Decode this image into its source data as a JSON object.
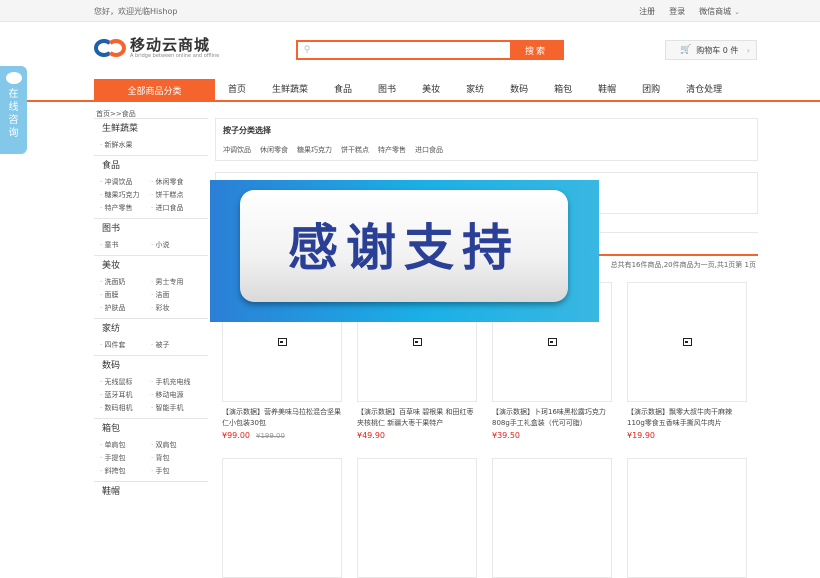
{
  "topbar": {
    "greeting": "您好，欢迎光临Hishop",
    "links": [
      "注册",
      "登录",
      "微信商城"
    ]
  },
  "header": {
    "logo_name": "移动云商城",
    "logo_slogan": "A bridge between online and offline",
    "search_placeholder": "",
    "search_button": "搜索",
    "cart_label": "购物车 0 件"
  },
  "nav": {
    "all_categories": "全部商品分类",
    "items": [
      "首页",
      "生鲜蔬菜",
      "食品",
      "图书",
      "美妆",
      "家纺",
      "数码",
      "箱包",
      "鞋帽",
      "团购",
      "清仓处理"
    ]
  },
  "consult": {
    "label": "在线咨询"
  },
  "breadcrumb": "首页>>食品",
  "sidebar": [
    {
      "title": "生鲜蔬菜",
      "items": [
        "新鲜水果"
      ]
    },
    {
      "title": "食品",
      "items": [
        "冲调饮品",
        "休闲零食",
        "糖果巧克力",
        "饼干糕点",
        "特产零售",
        "进口食品"
      ]
    },
    {
      "title": "图书",
      "items": [
        "童书",
        "小说"
      ]
    },
    {
      "title": "美妆",
      "items": [
        "洗面奶",
        "男士专用",
        "面膜",
        "洁面",
        "护肤品",
        "彩妆"
      ]
    },
    {
      "title": "家纺",
      "items": [
        "四件套",
        "被子"
      ]
    },
    {
      "title": "数码",
      "items": [
        "无线鼠标",
        "手机充电线",
        "蓝牙耳机",
        "移动电源",
        "数码相机",
        "智能手机"
      ]
    },
    {
      "title": "箱包",
      "items": [
        "单肩包",
        "双肩包",
        "手提包",
        "背包",
        "斜挎包",
        "手包"
      ]
    },
    {
      "title": "鞋帽",
      "items": []
    }
  ],
  "filter": {
    "title": "按子分类选择",
    "options": [
      "冲调饮品",
      "休闲零食",
      "糖果巧克力",
      "饼干糕点",
      "特产零售",
      "进口食品"
    ]
  },
  "pager_info": "总共有16件商品,20件商品为一页,共1页第 1页",
  "products": [
    {
      "title": "【演示数据】营养美味马拉松混合坚果仁小包装30包",
      "price": "¥99.00",
      "old_price": "¥199.00"
    },
    {
      "title": "【演示数据】百草味 碧根果 和田红枣夹核桃仁 新疆大枣干果特产",
      "price": "¥49.90",
      "old_price": ""
    },
    {
      "title": "【演示数据】卜珂16味黑松露巧克力808g手工礼盒装（代可可脂）",
      "price": "¥39.50",
      "old_price": ""
    },
    {
      "title": "【演示数据】飘零大叔牛肉干麻辣110g零食五香味手撕风牛肉片",
      "price": "¥19.90",
      "old_price": ""
    }
  ],
  "overlay": {
    "text": "感谢支持"
  }
}
